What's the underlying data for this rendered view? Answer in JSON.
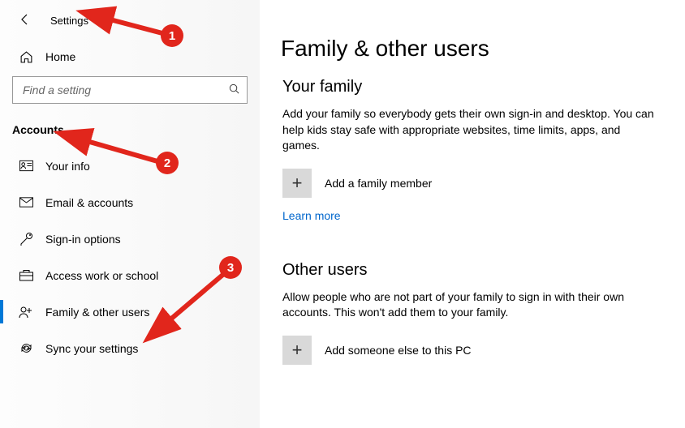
{
  "header": {
    "title": "Settings"
  },
  "home_label": "Home",
  "search": {
    "placeholder": "Find a setting"
  },
  "category": "Accounts",
  "nav": [
    {
      "label": "Your info",
      "icon": "user-card"
    },
    {
      "label": "Email & accounts",
      "icon": "mail"
    },
    {
      "label": "Sign-in options",
      "icon": "key"
    },
    {
      "label": "Access work or school",
      "icon": "briefcase"
    },
    {
      "label": "Family & other users",
      "icon": "people",
      "selected": true
    },
    {
      "label": "Sync your settings",
      "icon": "sync"
    }
  ],
  "main": {
    "title": "Family & other users",
    "section1": {
      "heading": "Your family",
      "desc": "Add your family so everybody gets their own sign-in and desktop. You can help kids stay safe with appropriate websites, time limits, apps, and games.",
      "add_label": "Add a family member",
      "learn_more": "Learn more"
    },
    "section2": {
      "heading": "Other users",
      "desc": "Allow people who are not part of your family to sign in with their own accounts. This won't add them to your family.",
      "add_label": "Add someone else to this PC"
    }
  },
  "annotations": [
    "1",
    "2",
    "3"
  ]
}
